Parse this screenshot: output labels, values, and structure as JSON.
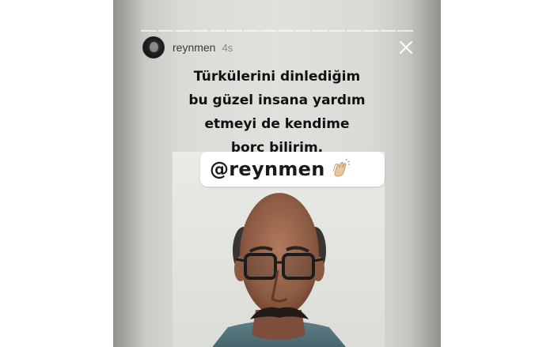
{
  "story": {
    "progress_segments": 16,
    "username": "reynmen",
    "timestamp": "4s",
    "caption_lines": [
      "Türkülerini dinlediğim",
      "bu güzel insana yardım",
      "etmeyi de kendime",
      "borç bilirim."
    ],
    "mention": "@reynmen",
    "icons": {
      "close": "close-icon",
      "clap": "clapping-hands-icon",
      "avatar": "profile-avatar"
    },
    "colors": {
      "background": "#dfe1dd",
      "caption_text": "#111111",
      "username_text": "#3a3a3a",
      "mention_sticker": "#ffffff"
    }
  }
}
